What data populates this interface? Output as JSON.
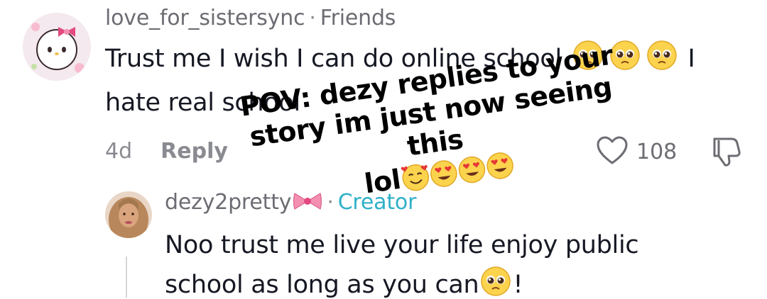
{
  "comment": {
    "username": "love_for_sistersync",
    "relation": "Friends",
    "text_line1": "Trust me I wish I can do online school",
    "text_line1_tail": "I",
    "text_line2": "hate real school",
    "age": "4d",
    "reply_label": "Reply",
    "like_count": "108"
  },
  "reply": {
    "username": "dezy2pretty",
    "badge": "Creator",
    "text_line1": "Noo trust me live your life enjoy public",
    "text_line2": "school as long as you can",
    "text_line2_tail": "!"
  },
  "overlay": {
    "line1": "POV: dezy replies to your",
    "line2": "story im just now seeing this",
    "line3": "lol"
  },
  "colors": {
    "text": "#161823",
    "muted": "#8a8b91",
    "creator": "#2fb0c8",
    "emoji": "#fcd34d"
  },
  "icons": [
    "pleading-face-emoji",
    "heart-outline-icon",
    "dislike-icon",
    "bow-emoji",
    "heart-eyes-emoji",
    "smiling-hearts-emoji"
  ]
}
